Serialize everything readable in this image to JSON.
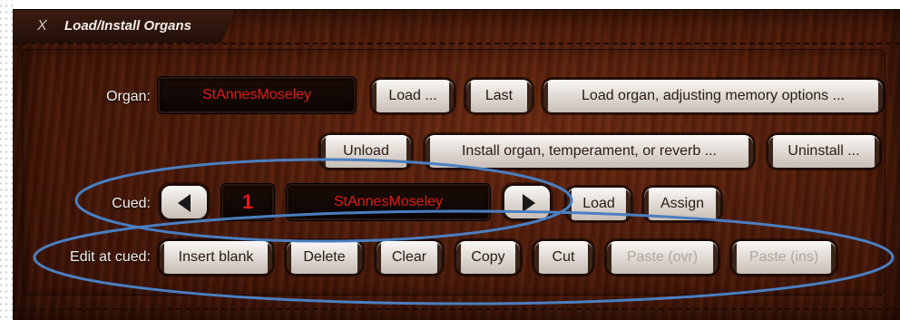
{
  "window": {
    "title": "Load/Install Organs",
    "close_icon": "close-icon",
    "close_glyph": "X"
  },
  "organ_row": {
    "label": "Organ:",
    "organ_name": "StAnnesMoseley",
    "load_label": "Load ...",
    "last_label": "Last",
    "load_adjust_label": "Load organ, adjusting memory options ..."
  },
  "install_row": {
    "unload_label": "Unload",
    "install_label": "Install organ, temperament, or reverb ...",
    "uninstall_label": "Uninstall ..."
  },
  "cued_row": {
    "label": "Cued:",
    "prev_icon": "arrow-left-icon",
    "next_icon": "arrow-right-icon",
    "cue_number": "1",
    "cued_organ": "StAnnesMoseley",
    "load_label": "Load",
    "assign_label": "Assign"
  },
  "edit_row": {
    "label": "Edit at cued:",
    "insert_blank_label": "Insert blank",
    "delete_label": "Delete",
    "clear_label": "Clear",
    "copy_label": "Copy",
    "cut_label": "Cut",
    "paste_ovr_label": "Paste (ovr)",
    "paste_ins_label": "Paste (ins)"
  },
  "colors": {
    "wood_dark": "#2f0e04",
    "wood_mid": "#6a2a12",
    "display_text": "#e11a16",
    "annotation_ellipse": "#4a7fc1",
    "disabled_text": "#b1a6a0"
  }
}
